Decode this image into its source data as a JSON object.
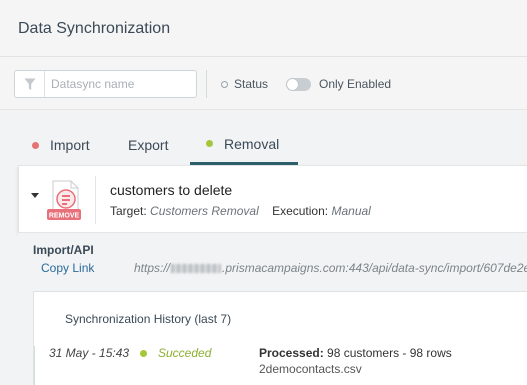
{
  "header": {
    "title": "Data Synchronization"
  },
  "filters": {
    "search_placeholder": "Datasync name",
    "status_label": "Status",
    "only_enabled_label": "Only Enabled"
  },
  "tabs": [
    {
      "label": "Import",
      "dot_color": "#e57373"
    },
    {
      "label": "Export"
    },
    {
      "label": "Removal",
      "dot_color": "#a4c639",
      "active": true
    }
  ],
  "sync_item": {
    "name": "customers to delete",
    "icon_badge": "REMOVE",
    "target_label": "Target:",
    "target_value": "Customers Removal",
    "execution_label": "Execution:",
    "execution_value": "Manual"
  },
  "detail": {
    "section_label": "Import/API",
    "copy_link_label": "Copy Link",
    "url_prefix": "https://",
    "url_suffix": ".prismacampaigns.com:443/api/data-sync/import/607de2e",
    "history_title": "Synchronization History (last 7)",
    "history": [
      {
        "date": "31 May - 15:43",
        "status": "Succeded",
        "processed_label": "Processed:",
        "processed_value": "98 customers - 98 rows",
        "file": "2democontacts.csv"
      }
    ]
  },
  "colors": {
    "accent": "#2e5f6c",
    "success": "#a4c639",
    "link": "#2a6a9a",
    "remove_badge": "#e8707a"
  }
}
